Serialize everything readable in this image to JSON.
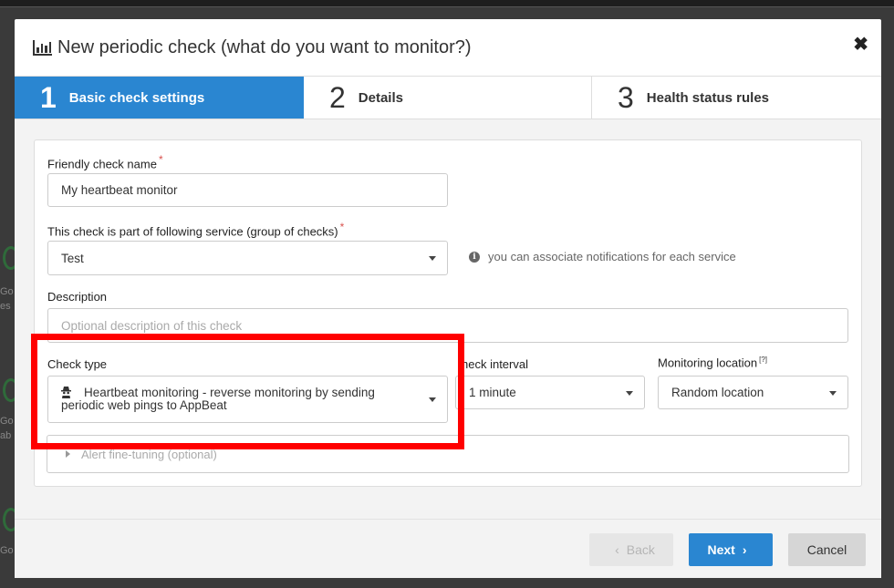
{
  "background": {
    "side_text": [
      "Go",
      "es",
      "Go",
      "ab",
      "Go"
    ]
  },
  "modal": {
    "title": "New periodic check (what do you want to monitor?)",
    "close_label": "✖"
  },
  "steps": [
    {
      "number": "1",
      "label": "Basic check settings",
      "active": true
    },
    {
      "number": "2",
      "label": "Details",
      "active": false
    },
    {
      "number": "3",
      "label": "Health status rules",
      "active": false
    }
  ],
  "form": {
    "friendly_name": {
      "label": "Friendly check name",
      "required_mark": "*",
      "value": "My heartbeat monitor"
    },
    "service": {
      "label": "This check is part of following service (group of checks)",
      "required_mark": "*",
      "value": "Test",
      "hint": "you can associate notifications for each service"
    },
    "description": {
      "label": "Description",
      "placeholder": "Optional description of this check"
    },
    "check_type": {
      "label": "Check type",
      "value_line1": "Heartbeat monitoring - reverse monitoring by sending",
      "value_line2": "periodic web pings to AppBeat"
    },
    "check_interval": {
      "label": "heck interval",
      "value": "1 minute"
    },
    "monitoring_location": {
      "label": "Monitoring location",
      "help_mark": "[?]",
      "value": "Random location"
    },
    "alert_finetuning": {
      "label": "Alert fine-tuning (optional)"
    }
  },
  "footer": {
    "back_label": "Back",
    "next_label": "Next",
    "cancel_label": "Cancel"
  },
  "colors": {
    "accent": "#2a86d1",
    "highlight": "#ff0000"
  },
  "icons": {
    "title": "bar-chart-icon",
    "close": "close-icon",
    "info": "info-icon",
    "check_type": "spy-icon"
  }
}
